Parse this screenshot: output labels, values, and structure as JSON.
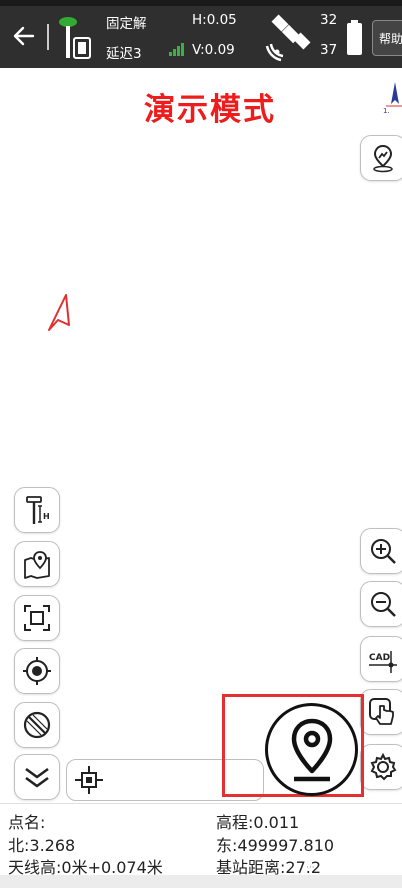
{
  "topbar": {
    "solution_status": "固定解",
    "delay": "延迟3",
    "h_precision": "H:0.05",
    "v_precision": "V:0.09",
    "sats_used": "32",
    "sats_visible": "37",
    "help_label": "帮助"
  },
  "map": {
    "demo_mode_title": "演示模式",
    "compass_scale": "1."
  },
  "info": {
    "point_name": "点名:",
    "elevation": "高程:0.011",
    "north": "北:3.268",
    "east": "东:499997.810",
    "antenna_height": "天线高:0米+0.074米",
    "base_distance": "基站距离:27.2"
  },
  "bottom": {
    "indicator": "···"
  },
  "colors": {
    "topbar_bg": "#2f2f2f",
    "demo_title": "#ee1c1c",
    "highlight": "#e53030",
    "signal": "#3cb043",
    "rtk_fixed": "#33aa33"
  },
  "icons": {
    "back": "arrow-left-icon",
    "rtk": "rtk-receiver-icon",
    "signal": "signal-bars-icon",
    "satellite": "satellite-icon",
    "battery": "battery-icon",
    "compass": "compass-icon",
    "location_arrow": "location-arrow-icon",
    "map_pin_layer": "map-pin-layer-icon",
    "pole_height": "pole-height-icon",
    "map_marker": "map-marker-icon",
    "full_extent": "full-extent-icon",
    "target": "target-icon",
    "no_entry": "no-entry-icon",
    "collapse": "double-chevron-icon",
    "center_location": "center-location-icon",
    "zoom_in": "zoom-in-icon",
    "zoom_out": "zoom-out-icon",
    "cad": "cad-icon",
    "hand_pointer": "hand-pointer-icon",
    "settings": "gear-icon",
    "collect_point": "collect-point-icon"
  }
}
